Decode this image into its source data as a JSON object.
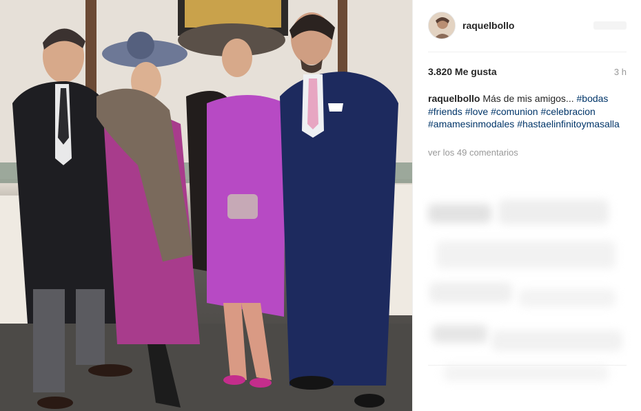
{
  "post": {
    "username": "raquelbollo",
    "likes": "3.820 Me gusta",
    "time": "3 h",
    "caption_user": "raquelbollo",
    "caption_text": "Más de mis amigos...",
    "hashtags": [
      "#bodas",
      "#friends",
      "#love",
      "#comunion",
      "#celebracion",
      "#amamesinmodales",
      "#hastaelinfinitoymasalla"
    ],
    "view_comments": "ver los 49 comentarios"
  },
  "icons": {
    "avatar": "profile-avatar"
  },
  "colors": {
    "hashtag": "#003569",
    "muted": "#999999",
    "text": "#262626",
    "divider": "#efefef"
  }
}
